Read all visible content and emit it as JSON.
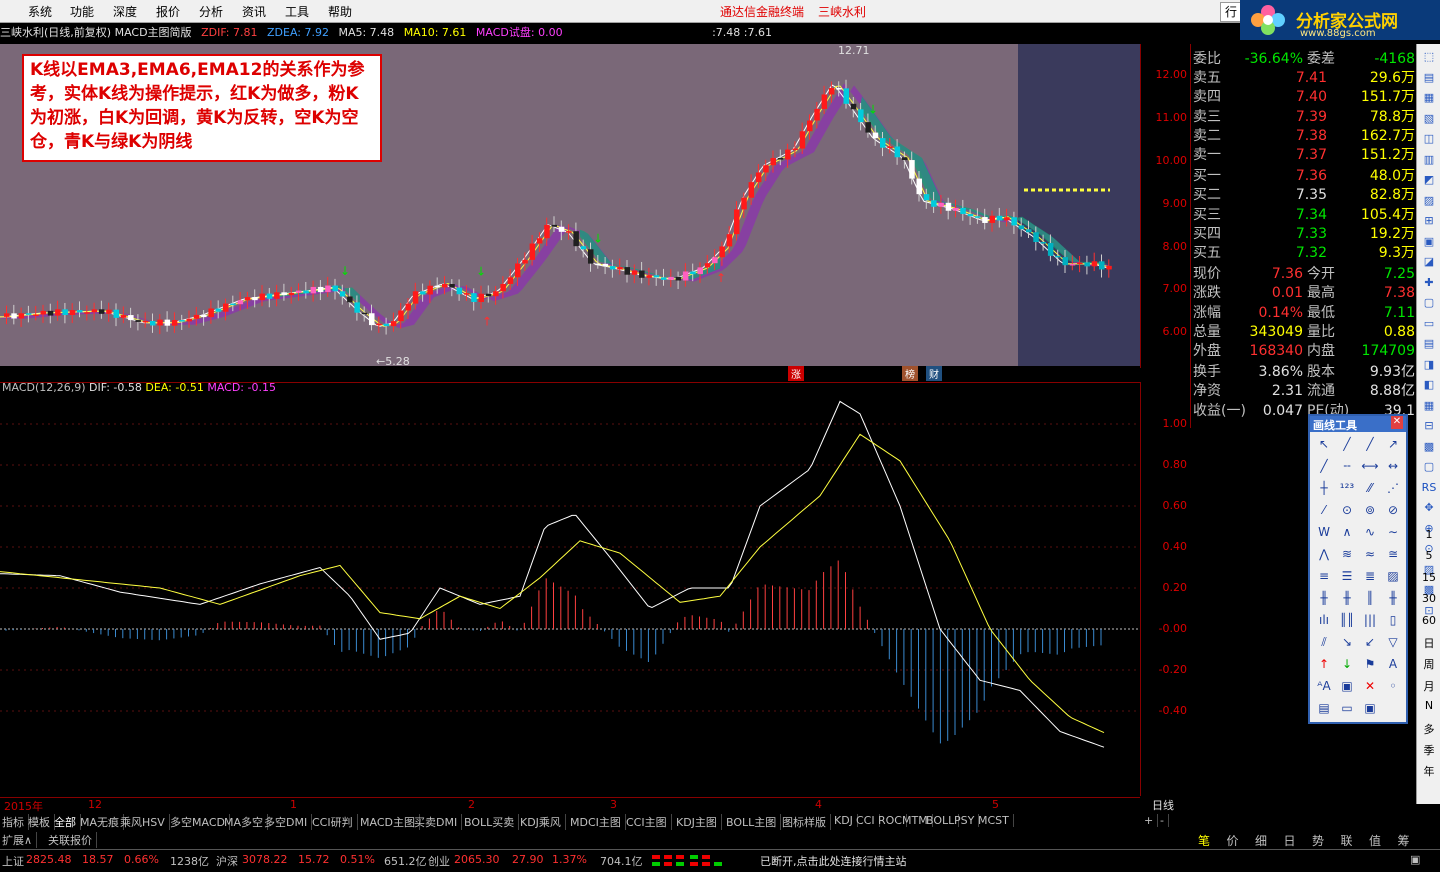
{
  "menubar": {
    "items": [
      "系统",
      "功能",
      "深度",
      "报价",
      "分析",
      "资讯",
      "工具",
      "帮助"
    ],
    "title": "通达信金融终端",
    "stock": "三峡水利",
    "tab": "行"
  },
  "logo": {
    "title": "分析家公式网",
    "url_text": "www.88gs.com"
  },
  "infobar": {
    "name": "三峡水利(日线,前复权) MACD主图简版",
    "zdif": "ZDIF: 7.81",
    "zdea": "ZDEA: 7.92",
    "ma5": "MA5: 7.48",
    "ma10": "MA10: 7.61",
    "macd_trial": "MACD试盘: 0.00",
    "extra": ":7.48 :7.61"
  },
  "annotation": "K线以EMA3,EMA6,EMA12的关系作为参考，实体K线为操作提示，红K为做多，粉K为初涨，白K为回调，黄K为反转，空K为空仓，青K与绿K为阴线",
  "main_chart": {
    "high_label": "12.71",
    "low_label": "←5.28",
    "price_ticks": [
      "12.00",
      "11.00",
      "10.00",
      "9.00",
      "8.00",
      "7.00",
      "6.00"
    ],
    "markers": [
      "涨",
      "榜",
      "财"
    ]
  },
  "macd": {
    "label": "MACD(12,26,9)",
    "dif": "DIF: -0.58",
    "dea": "DEA: -0.51",
    "macd": "MACD: -0.15",
    "ticks": [
      "1.00",
      "0.80",
      "0.60",
      "0.40",
      "0.20",
      "-0.00",
      "-0.20",
      "-0.40"
    ]
  },
  "date_axis": [
    "2015年",
    "12",
    "1",
    "2",
    "3",
    "4",
    "5"
  ],
  "period_label": "日线",
  "indicator_tabs": [
    "指标",
    "模板",
    "全部",
    "MA无痕",
    "乘风HSV",
    "多空MACD",
    "MA多空",
    "多空DMI",
    "CCI研判",
    "MACD主图",
    "买卖DMI",
    "BOLL买卖",
    "KDJ乘风",
    "MDCI主图",
    "CCI主图",
    "KDJ主图",
    "BOLL主图",
    "图标样版",
    "KDJ",
    "CCI",
    "ROC",
    "MTM",
    "BOLL",
    "PSY",
    "MCST"
  ],
  "ext_tabs": [
    "扩展∧",
    "关联报价"
  ],
  "quote": {
    "weibi": {
      "label": "委比",
      "v1": "-36.64%",
      "label2": "委差",
      "v2": "-4168"
    },
    "asks": [
      {
        "label": "卖五",
        "price": "7.41",
        "vol": "29.6万"
      },
      {
        "label": "卖四",
        "price": "7.40",
        "vol": "151.7万"
      },
      {
        "label": "卖三",
        "price": "7.39",
        "vol": "78.8万"
      },
      {
        "label": "卖二",
        "price": "7.38",
        "vol": "162.7万"
      },
      {
        "label": "卖一",
        "price": "7.37",
        "vol": "151.2万"
      }
    ],
    "bids": [
      {
        "label": "买一",
        "price": "7.36",
        "vol": "48.0万"
      },
      {
        "label": "买二",
        "price": "7.35",
        "vol": "82.8万"
      },
      {
        "label": "买三",
        "price": "7.34",
        "vol": "105.4万"
      },
      {
        "label": "买四",
        "price": "7.33",
        "vol": "19.2万"
      },
      {
        "label": "买五",
        "price": "7.32",
        "vol": "9.3万"
      }
    ],
    "stats": [
      {
        "l1": "现价",
        "v1": "7.36",
        "l2": "今开",
        "v2": "7.25"
      },
      {
        "l1": "涨跌",
        "v1": "0.01",
        "l2": "最高",
        "v2": "7.38"
      },
      {
        "l1": "涨幅",
        "v1": "0.14%",
        "l2": "最低",
        "v2": "7.11"
      },
      {
        "l1": "总量",
        "v1": "343049",
        "l2": "量比",
        "v2": "0.88"
      },
      {
        "l1": "外盘",
        "v1": "168340",
        "l2": "内盘",
        "v2": "174709"
      }
    ],
    "stats2": [
      {
        "l1": "换手",
        "v1": "3.86%",
        "l2": "股本",
        "v2": "9.93亿"
      },
      {
        "l1": "净资",
        "v1": "2.31",
        "l2": "流通",
        "v2": "8.88亿"
      },
      {
        "l1": "收益(一)",
        "v1": "0.047",
        "l2": "PE(动)",
        "v2": "39.1"
      }
    ]
  },
  "palette": {
    "title": "画线工具"
  },
  "right_tools": [
    "1",
    "5",
    "15",
    "30",
    "60",
    "日",
    "周",
    "月",
    "N",
    "多",
    "季",
    "年"
  ],
  "br_tabs": [
    "笔",
    "价",
    "细",
    "日",
    "势",
    "联",
    "值",
    "筹"
  ],
  "statusbar": {
    "sh_label": "上证",
    "sh_val": "2825.48",
    "sh_chg": "18.57",
    "sh_pct": "0.66%",
    "sh_amt": "1238亿",
    "hs_label": "沪深",
    "hs_val": "3078.22",
    "hs_chg": "15.72",
    "hs_pct": "0.51%",
    "hs_amt": "651.2亿",
    "cy_label": "创业",
    "cy_val": "2065.30",
    "cy_chg": "27.90",
    "cy_pct": "1.37%",
    "cy_amt": "704.1亿",
    "msg": "已断开,点击此处连接行情主站"
  },
  "colors": {
    "up": "#ff3030",
    "down": "#00e600",
    "bg_chart": "#7a6878"
  }
}
